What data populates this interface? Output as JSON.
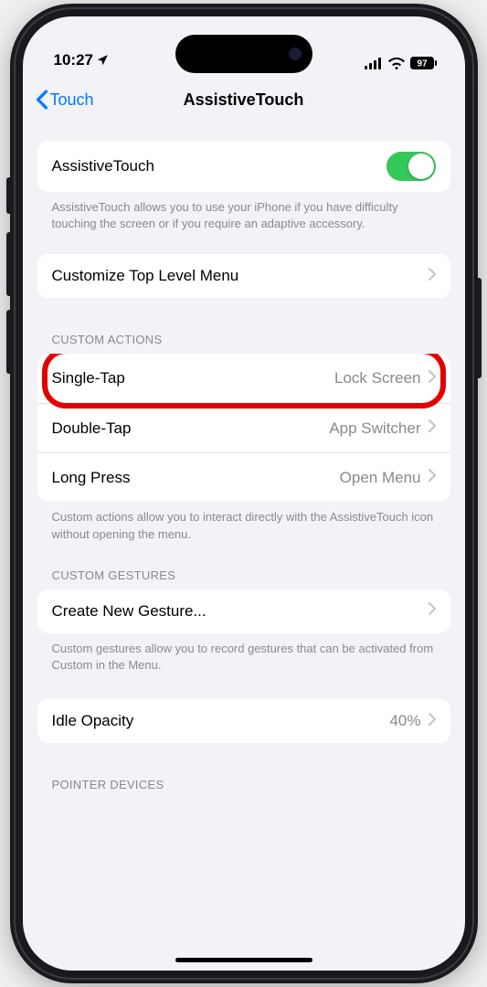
{
  "status": {
    "time": "10:27",
    "battery": "97"
  },
  "nav": {
    "back": "Touch",
    "title": "AssistiveTouch"
  },
  "main_toggle": {
    "label": "AssistiveTouch",
    "footer": "AssistiveTouch allows you to use your iPhone if you have difficulty touching the screen or if you require an adaptive accessory."
  },
  "customize_row": {
    "label": "Customize Top Level Menu"
  },
  "custom_actions": {
    "header": "CUSTOM ACTIONS",
    "rows": [
      {
        "label": "Single-Tap",
        "value": "Lock Screen"
      },
      {
        "label": "Double-Tap",
        "value": "App Switcher"
      },
      {
        "label": "Long Press",
        "value": "Open Menu"
      }
    ],
    "footer": "Custom actions allow you to interact directly with the AssistiveTouch icon without opening the menu."
  },
  "custom_gestures": {
    "header": "CUSTOM GESTURES",
    "row": {
      "label": "Create New Gesture..."
    },
    "footer": "Custom gestures allow you to record gestures that can be activated from Custom in the Menu."
  },
  "idle_opacity": {
    "label": "Idle Opacity",
    "value": "40%"
  },
  "pointer_devices": {
    "header": "POINTER DEVICES"
  }
}
